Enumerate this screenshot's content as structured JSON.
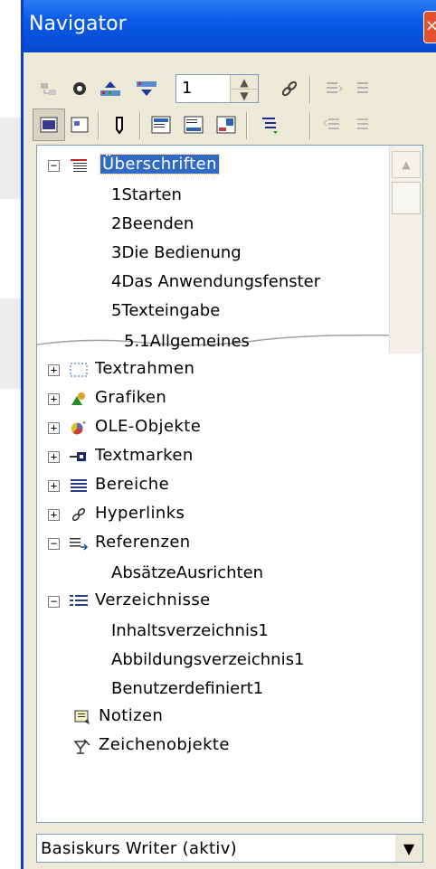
{
  "window": {
    "title": "Navigator",
    "close_glyph": "×"
  },
  "toolbar": {
    "row1": [
      {
        "name": "toggle-icon",
        "glyph": "⇆"
      },
      {
        "name": "navigation-icon",
        "glyph": "◉"
      },
      {
        "name": "previous-icon",
        "glyph": "▲"
      },
      {
        "name": "next-icon",
        "glyph": "▼"
      }
    ],
    "page_number": "1",
    "row2": [
      {
        "name": "content-view-icon",
        "glyph": "▦"
      },
      {
        "name": "master-view-icon",
        "glyph": "▣"
      },
      {
        "name": "reminder-icon",
        "glyph": "✎"
      },
      {
        "name": "header-icon",
        "glyph": "▤"
      },
      {
        "name": "footer-icon",
        "glyph": "▥"
      },
      {
        "name": "anchor-icon",
        "glyph": "▧"
      },
      {
        "name": "heading-levels-icon",
        "glyph": "≣"
      }
    ]
  },
  "tree": {
    "headings": {
      "label": "Überschriften",
      "expander": "−",
      "icon": "heading-list-icon",
      "children": [
        "1Starten",
        "2Beenden",
        "3Die Bedienung",
        "4Das Anwendungsfenster",
        "5Texteingabe",
        "5.1Allgemeines"
      ]
    },
    "categories": [
      {
        "label": "Textrahmen",
        "expander": "+",
        "icon": "text-frame-icon"
      },
      {
        "label": "Grafiken",
        "expander": "+",
        "icon": "graphics-icon"
      },
      {
        "label": "OLE-Objekte",
        "expander": "+",
        "icon": "ole-object-icon"
      },
      {
        "label": "Textmarken",
        "expander": "+",
        "icon": "bookmark-icon"
      },
      {
        "label": "Bereiche",
        "expander": "+",
        "icon": "section-icon"
      },
      {
        "label": "Hyperlinks",
        "expander": "+",
        "icon": "hyperlink-icon"
      }
    ],
    "references": {
      "label": "Referenzen",
      "expander": "−",
      "icon": "reference-icon",
      "children": [
        "AbsätzeAusrichten"
      ]
    },
    "indexes": {
      "label": "Verzeichnisse",
      "expander": "−",
      "icon": "index-icon",
      "children": [
        "Inhaltsverzeichnis1",
        "Abbildungsverzeichnis1",
        "Benutzerdefiniert1"
      ]
    },
    "notes": {
      "label": "Notizen",
      "icon": "comment-icon"
    },
    "drawings": {
      "label": "Zeichenobjekte",
      "icon": "drawing-object-icon"
    }
  },
  "document_select": {
    "value": "Basiskurs Writer (aktiv)"
  },
  "colors": {
    "titlebar": "#0a5ae8",
    "selection": "#316ac5",
    "window_bg": "#ece9d8"
  }
}
